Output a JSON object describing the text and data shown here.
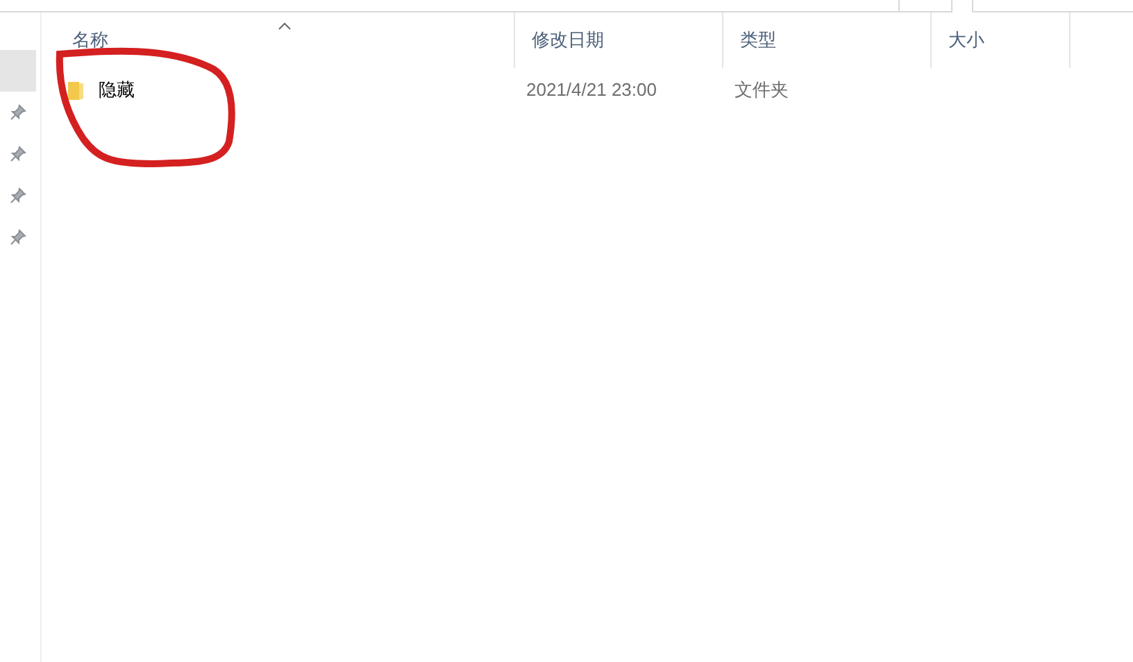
{
  "nav_pane": {
    "items": [
      {
        "selected": true,
        "pinned": false
      },
      {
        "selected": false,
        "pinned": true
      },
      {
        "selected": false,
        "pinned": true
      },
      {
        "selected": false,
        "pinned": true
      },
      {
        "selected": false,
        "pinned": true
      }
    ]
  },
  "file_list": {
    "columns": [
      {
        "label": "名称",
        "sorted": true
      },
      {
        "label": "修改日期",
        "sorted": false
      },
      {
        "label": "类型",
        "sorted": false
      },
      {
        "label": "大小",
        "sorted": false
      }
    ],
    "rows": [
      {
        "kind": "folder",
        "name": "隐藏",
        "modified": "2021/4/21 23:00",
        "type": "文件夹",
        "size": ""
      }
    ]
  },
  "annotation": {
    "kind": "circle",
    "color": "#d42020"
  }
}
